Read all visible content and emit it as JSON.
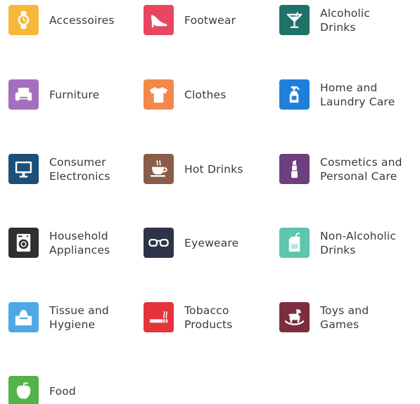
{
  "categories": [
    {
      "label": "Accessoires",
      "icon": "watch-icon",
      "color": "#F5B83A"
    },
    {
      "label": "Footwear",
      "icon": "high-heel-icon",
      "color": "#E8465F"
    },
    {
      "label": "Alcoholic\nDrinks",
      "icon": "cocktail-icon",
      "color": "#1E7268"
    },
    {
      "label": "Furniture",
      "icon": "armchair-icon",
      "color": "#A56FC0"
    },
    {
      "label": "Clothes",
      "icon": "t-shirt-icon",
      "color": "#F2894A"
    },
    {
      "label": "Home and\nLaundry Care",
      "icon": "spray-bottle-icon",
      "color": "#1F80DB"
    },
    {
      "label": "Consumer\nElectronics",
      "icon": "monitor-icon",
      "color": "#1D4F79"
    },
    {
      "label": "Hot Drinks",
      "icon": "coffee-cup-icon",
      "color": "#8A5D49"
    },
    {
      "label": "Cosmetics and\nPersonal Care",
      "icon": "lipstick-icon",
      "color": "#6E3F7E"
    },
    {
      "label": "Household\nAppliances",
      "icon": "washing-machine-icon",
      "color": "#2F2F2F"
    },
    {
      "label": "Eyeweare",
      "icon": "glasses-icon",
      "color": "#2D3447"
    },
    {
      "label": "Non-Alcoholic\nDrinks",
      "icon": "juice-box-icon",
      "color": "#5CC6AF"
    },
    {
      "label": "Tissue and\nHygiene",
      "icon": "tissue-box-icon",
      "color": "#4DA9E3"
    },
    {
      "label": "Tobacco\nProducts",
      "icon": "cigarette-icon",
      "color": "#E5333A"
    },
    {
      "label": "Toys and\nGames",
      "icon": "rocking-horse-icon",
      "color": "#7C2E3E"
    },
    {
      "label": "Food",
      "icon": "apple-icon",
      "color": "#52B34A"
    }
  ]
}
